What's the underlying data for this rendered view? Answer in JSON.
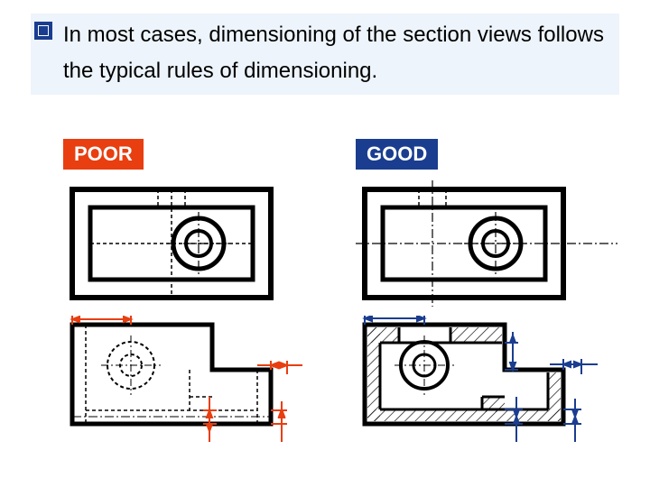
{
  "lead": "In most cases, dimensioning of the section views follows the typical rules of dimensioning.",
  "labels": {
    "poor": "POOR",
    "good": "GOOD"
  }
}
